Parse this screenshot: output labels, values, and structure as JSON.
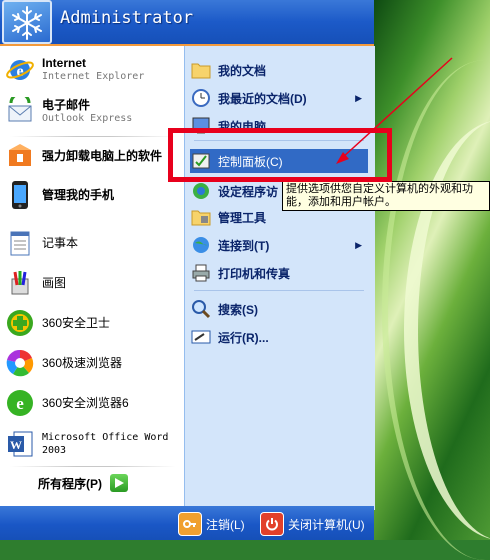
{
  "user": {
    "name": "Administrator"
  },
  "pinned": [
    {
      "name": "Internet",
      "sub": "Internet Explorer"
    },
    {
      "name": "电子邮件",
      "sub": "Outlook Express"
    }
  ],
  "recent": [
    {
      "name": "强力卸载电脑上的软件"
    },
    {
      "name": "管理我的手机"
    },
    {
      "name": "记事本"
    },
    {
      "name": "画图"
    },
    {
      "name": "360安全卫士"
    },
    {
      "name": "360极速浏览器"
    },
    {
      "name": "360安全浏览器6"
    },
    {
      "name": "Microsoft Office Word 2003"
    }
  ],
  "all_programs": "所有程序(P)",
  "places": [
    {
      "label": "我的文档"
    },
    {
      "label": "我最近的文档(D)"
    },
    {
      "label": "我的电脑"
    },
    {
      "label": "控制面板(C)"
    },
    {
      "label": "设定程序访"
    },
    {
      "label": "管理工具"
    },
    {
      "label": "连接到(T)"
    },
    {
      "label": "打印机和传真"
    },
    {
      "label": "搜索(S)"
    },
    {
      "label": "运行(R)..."
    }
  ],
  "tooltip": "提供选项供您自定义计算机的外观和功能，添加和用户帐户。",
  "footer": {
    "logoff": "注销(L)",
    "shutdown": "关闭计算机(U)"
  },
  "colors": {
    "header": "#1c5ac8",
    "highlight": "#316ac5",
    "annotation": "#e8001c",
    "tooltip_bg": "#ffffe1"
  },
  "annotation": {
    "type": "red-box-with-arrow",
    "target": "控制面板(C)"
  }
}
